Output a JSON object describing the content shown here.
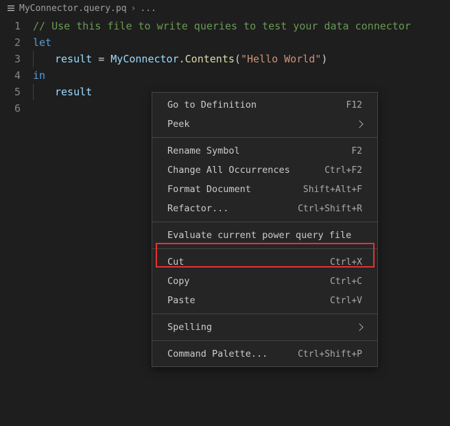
{
  "breadcrumb": {
    "file": "MyConnector.query.pq",
    "tail": "..."
  },
  "lines": [
    "1",
    "2",
    "3",
    "4",
    "5",
    "6"
  ],
  "code": {
    "l1_comment": "// Use this file to write queries to test your data connector",
    "l2_let": "let",
    "l3_result": "result",
    "l3_eq": " = ",
    "l3_obj": "MyConnector",
    "l3_dot": ".",
    "l3_fn": "Contents",
    "l3_open": "(",
    "l3_str": "\"Hello World\"",
    "l3_close": ")",
    "l4_in": "in",
    "l5_result": "result"
  },
  "menu": {
    "goto": {
      "label": "Go to Definition",
      "shortcut": "F12"
    },
    "peek": {
      "label": "Peek"
    },
    "rename": {
      "label": "Rename Symbol",
      "shortcut": "F2"
    },
    "changeAll": {
      "label": "Change All Occurrences",
      "shortcut": "Ctrl+F2"
    },
    "format": {
      "label": "Format Document",
      "shortcut": "Shift+Alt+F"
    },
    "refactor": {
      "label": "Refactor...",
      "shortcut": "Ctrl+Shift+R"
    },
    "evaluate": {
      "label": "Evaluate current power query file"
    },
    "cut": {
      "label": "Cut",
      "shortcut": "Ctrl+X"
    },
    "copy": {
      "label": "Copy",
      "shortcut": "Ctrl+C"
    },
    "paste": {
      "label": "Paste",
      "shortcut": "Ctrl+V"
    },
    "spelling": {
      "label": "Spelling"
    },
    "palette": {
      "label": "Command Palette...",
      "shortcut": "Ctrl+Shift+P"
    }
  }
}
